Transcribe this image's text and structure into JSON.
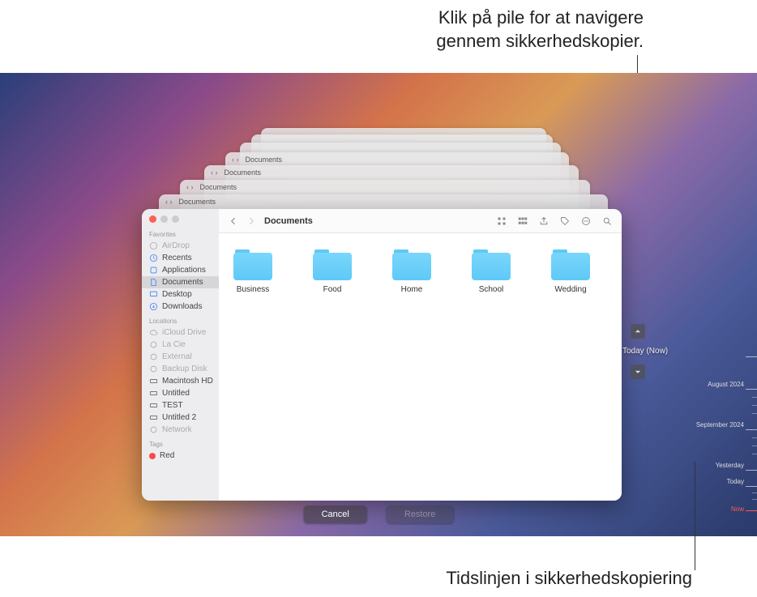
{
  "annotations": {
    "top_line1": "Klik på pile for at navigere",
    "top_line2": "gennem sikkerhedskopier.",
    "bottom": "Tidslinjen i sikkerhedskopiering"
  },
  "window": {
    "title": "Documents",
    "ghost_title": "Documents"
  },
  "sidebar": {
    "favorites_header": "Favorites",
    "locations_header": "Locations",
    "tags_header": "Tags",
    "items": {
      "airdrop": "AirDrop",
      "recents": "Recents",
      "applications": "Applications",
      "documents": "Documents",
      "desktop": "Desktop",
      "downloads": "Downloads",
      "icloud": "iCloud Drive",
      "lacie": "La Cie",
      "external": "External",
      "backupdisk": "Backup Disk",
      "macintoshhd": "Macintosh HD",
      "untitled": "Untitled",
      "test": "TEST",
      "untitled2": "Untitled 2",
      "network": "Network",
      "tag_red": "Red"
    }
  },
  "folders": [
    "Business",
    "Food",
    "Home",
    "School",
    "Wedding"
  ],
  "nav": {
    "now_label": "Today (Now)"
  },
  "timeline": {
    "labels": [
      "August 2024",
      "September 2024",
      "Yesterday",
      "Today",
      "Now"
    ]
  },
  "buttons": {
    "cancel": "Cancel",
    "restore": "Restore"
  }
}
